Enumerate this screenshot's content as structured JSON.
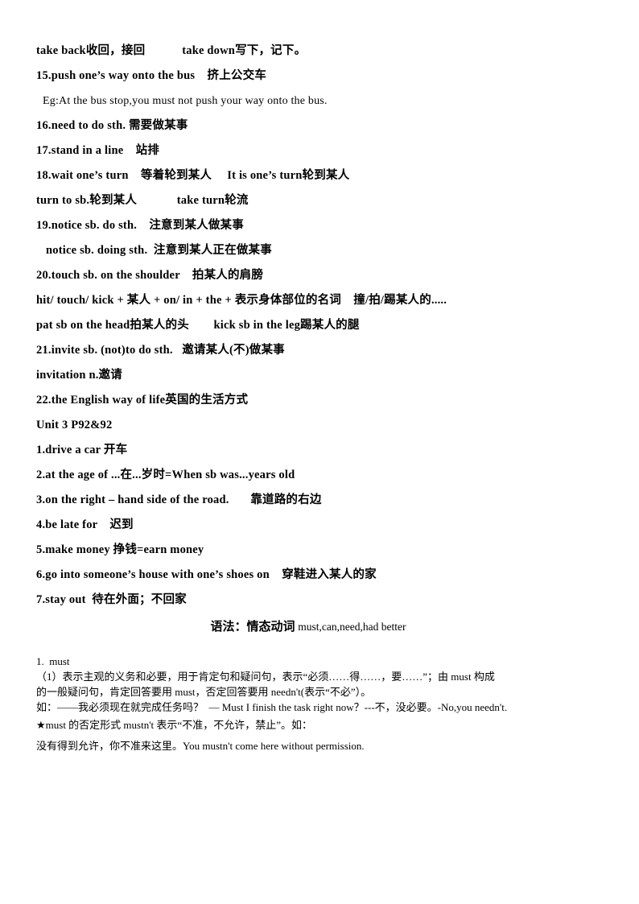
{
  "document": {
    "vocab_lines": [
      {
        "text": "take back收回，接回            take down写下，记下。",
        "style": "bold"
      },
      {
        "text": "15.push one’s way onto the bus    挤上公交车",
        "style": "bold"
      },
      {
        "text": "Eg:At the bus stop,you must not push your way onto the bus.",
        "style": "plain",
        "indent": "indent1"
      },
      {
        "text": "16.need to do sth. 需要做某事",
        "style": "bold"
      },
      {
        "text": "17.stand in a line    站排",
        "style": "bold"
      },
      {
        "text": "18.wait one’s turn    等着轮到某人     It is one’s turn轮到某人",
        "style": "bold"
      },
      {
        "text": "turn to sb.轮到某人             take turn轮流",
        "style": "bold"
      },
      {
        "text": "19.notice sb. do sth.    注意到某人做某事",
        "style": "bold"
      },
      {
        "text": "notice sb. doing sth.  注意到某人正在做某事",
        "style": "bold",
        "indent": "indent1"
      },
      {
        "text": "20.touch sb. on the shoulder    拍某人的肩膀",
        "style": "bold"
      },
      {
        "text": "hit/ touch/ kick + 某人 + on/ in + the + 表示身体部位的名词    撞/拍/踢某人的.....",
        "style": "bold"
      },
      {
        "text": "pat sb on the head拍某人的头        kick sb in the leg踢某人的腿",
        "style": "bold"
      },
      {
        "text": "21.invite sb. (not)to do sth.   邀请某人(不)做某事",
        "style": "bold"
      },
      {
        "text": "invitation n.邀请",
        "style": "bold"
      },
      {
        "text": "22.the English way of life英国的生活方式",
        "style": "bold"
      },
      {
        "text": "Unit 3 P92&92",
        "style": "bold"
      },
      {
        "text": "1.drive a car 开车",
        "style": "bold"
      },
      {
        "text": "2.at the age of ...在...岁时=When sb was...years old",
        "style": "bold"
      },
      {
        "text": "3.on the right – hand side of the road.       靠道路的右边",
        "style": "bold"
      },
      {
        "text": "4.be late for    迟到",
        "style": "bold"
      },
      {
        "text": "5.make money 挣钱=earn money",
        "style": "bold"
      },
      {
        "text": "6.go into someone’s house with one’s shoes on    穿鞋进入某人的家",
        "style": "bold"
      },
      {
        "text": "7.stay out  待在外面；不回家",
        "style": "bold"
      }
    ],
    "grammar_title_cn": "语法：情态动词 ",
    "grammar_title_en": "must,can,need,had better",
    "grammar_lines": [
      {
        "text": "1.  must",
        "spaced": false
      },
      {
        "text": "（1）表示主观的义务和必要，用于肯定句和疑问句，表示“必须……得……，要……”；由 must 构成",
        "spaced": false
      },
      {
        "text": "的一般疑问句，肯定回答要用 must，否定回答要用 needn't(表示“不必”）。",
        "spaced": false
      },
      {
        "text": "如：——我必须现在就完成任务吗？  — Must I finish the task right now？---不，没必要。-No,you needn't.",
        "spaced": false
      },
      {
        "text": "★must 的否定形式 mustn't 表示“不准，不允许，禁止”。如：",
        "spaced": true
      },
      {
        "text": "没有得到允许，你不准来这里。You mustn't come here without permission.",
        "spaced": true
      }
    ]
  }
}
